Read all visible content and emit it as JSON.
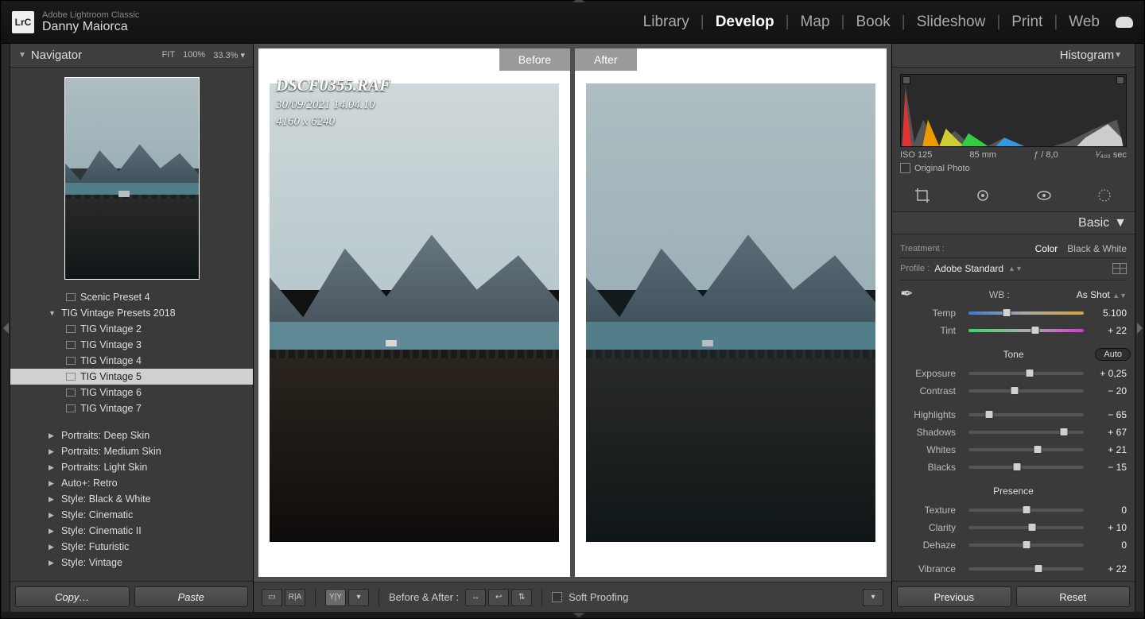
{
  "app": {
    "product": "Adobe Lightroom Classic",
    "catalog": "Danny Maiorca",
    "badge": "LrC"
  },
  "modules": {
    "items": [
      "Library",
      "Develop",
      "Map",
      "Book",
      "Slideshow",
      "Print",
      "Web"
    ],
    "active": "Develop"
  },
  "navigator": {
    "title": "Navigator",
    "zoom": [
      "FIT",
      "100%",
      "33.3%"
    ]
  },
  "presets": {
    "items": [
      {
        "label": "Scenic Preset 4",
        "kind": "preset",
        "indent": 2
      },
      {
        "label": "TIG Vintage Presets 2018",
        "kind": "group",
        "indent": 1,
        "expanded": true
      },
      {
        "label": "TIG Vintage 2",
        "kind": "preset",
        "indent": 2
      },
      {
        "label": "TIG Vintage 3",
        "kind": "preset",
        "indent": 2
      },
      {
        "label": "TIG Vintage 4",
        "kind": "preset",
        "indent": 2
      },
      {
        "label": "TIG Vintage 5",
        "kind": "preset",
        "indent": 2,
        "selected": true
      },
      {
        "label": "TIG Vintage 6",
        "kind": "preset",
        "indent": 2
      },
      {
        "label": "TIG Vintage 7",
        "kind": "preset",
        "indent": 2
      },
      {
        "label": "",
        "kind": "spacer"
      },
      {
        "label": "Portraits: Deep Skin",
        "kind": "group",
        "indent": 1
      },
      {
        "label": "Portraits: Medium Skin",
        "kind": "group",
        "indent": 1
      },
      {
        "label": "Portraits: Light Skin",
        "kind": "group",
        "indent": 1
      },
      {
        "label": "Auto+: Retro",
        "kind": "group",
        "indent": 1
      },
      {
        "label": "Style: Black & White",
        "kind": "group",
        "indent": 1
      },
      {
        "label": "Style: Cinematic",
        "kind": "group",
        "indent": 1
      },
      {
        "label": "Style: Cinematic II",
        "kind": "group",
        "indent": 1
      },
      {
        "label": "Style: Futuristic",
        "kind": "group",
        "indent": 1
      },
      {
        "label": "Style: Vintage",
        "kind": "group",
        "indent": 1
      }
    ]
  },
  "leftButtons": {
    "copy": "Copy…",
    "paste": "Paste"
  },
  "image": {
    "filename": "DSCF0355.RAF",
    "datetime": "30/09/2021 14.04.10",
    "dims": "4160 x 6240",
    "before": "Before",
    "after": "After"
  },
  "toolbar": {
    "label": "Before & After :",
    "soft": "Soft Proofing"
  },
  "rightButtons": {
    "prev": "Previous",
    "reset": "Reset"
  },
  "histogram": {
    "title": "Histogram",
    "iso": "ISO 125",
    "focal": "85 mm",
    "aperture": "ƒ / 8,0",
    "shutter": "¹⁄₄₀₀ sec",
    "original": "Original Photo"
  },
  "basic": {
    "title": "Basic",
    "treatment": {
      "label": "Treatment :",
      "color": "Color",
      "bw": "Black & White"
    },
    "profile": {
      "label": "Profile :",
      "value": "Adobe Standard"
    },
    "wb": {
      "label": "WB :",
      "value": "As Shot"
    },
    "tone_label": "Tone",
    "auto": "Auto",
    "presence_label": "Presence",
    "sliders": [
      {
        "name": "Temp",
        "value": "5.100",
        "pos": 33,
        "cls": "temp"
      },
      {
        "name": "Tint",
        "value": "+ 22",
        "pos": 58,
        "cls": "tint"
      }
    ],
    "tone": [
      {
        "name": "Exposure",
        "value": "+ 0,25",
        "pos": 53
      },
      {
        "name": "Contrast",
        "value": "− 20",
        "pos": 40
      }
    ],
    "tone2": [
      {
        "name": "Highlights",
        "value": "− 65",
        "pos": 18
      },
      {
        "name": "Shadows",
        "value": "+ 67",
        "pos": 83
      },
      {
        "name": "Whites",
        "value": "+ 21",
        "pos": 60
      },
      {
        "name": "Blacks",
        "value": "− 15",
        "pos": 42
      }
    ],
    "presence": [
      {
        "name": "Texture",
        "value": "0",
        "pos": 50
      },
      {
        "name": "Clarity",
        "value": "+ 10",
        "pos": 55
      },
      {
        "name": "Dehaze",
        "value": "0",
        "pos": 50
      }
    ],
    "vibrance": {
      "name": "Vibrance",
      "value": "+ 22",
      "pos": 61
    }
  }
}
